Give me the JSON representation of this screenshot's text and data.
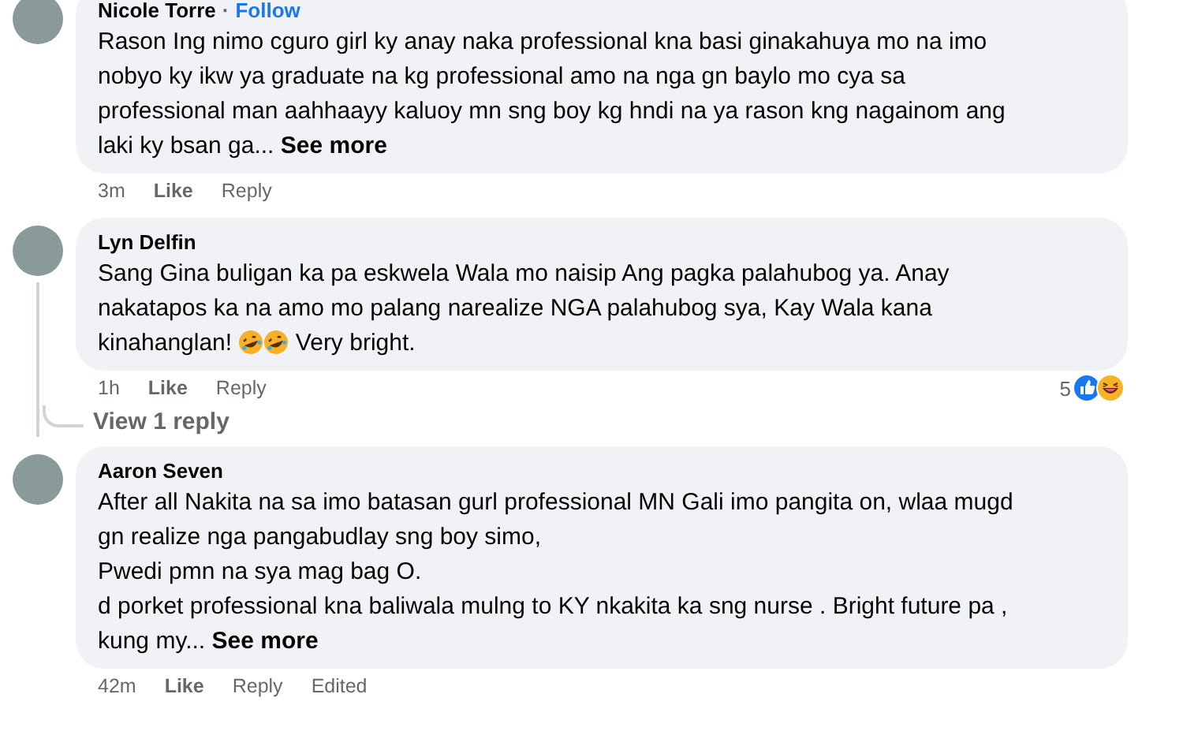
{
  "comments": [
    {
      "author": "Nicole Torre",
      "separator": "·",
      "follow": "Follow",
      "text_lines": [
        "Rason Ing nimo cguro girl ky anay naka professional kna basi ginakahuya mo na imo",
        "nobyo ky ikw ya graduate na kg professional amo na nga gn baylo mo cya sa",
        "professional man aahhaayy kaluoy mn sng boy kg hndi na ya rason kng nagainom ang",
        "laki ky bsan ga... **See more**"
      ],
      "time": "3m",
      "actions": [
        "Like",
        "Reply"
      ]
    },
    {
      "author": "Lyn Delfin",
      "text_lines": [
        "Sang Gina buligan ka pa eskwela Wala mo naisip Ang pagka palahubog ya. Anay",
        "nakatapos ka na amo mo palang narealize NGA palahubog sya, Kay Wala kana",
        "kinahanglan!"
      ],
      "inline_icons": [
        {
          "kind": "laughing"
        },
        {
          "kind": "laughing"
        }
      ],
      "after_icons": "Very bright.",
      "time": "1h",
      "actions": [
        "Like",
        "Reply"
      ],
      "reactions": {
        "count": "5",
        "icons": [
          {
            "kind": "like"
          },
          {
            "kind": "haha"
          }
        ]
      },
      "replies_link": "View 1 reply"
    },
    {
      "author": "Aaron Seven",
      "text_lines": [
        "After all Nakita na sa imo batasan gurl professional MN Gali imo pangita on, wlaa mugd",
        "gn realize nga pangabudlay sng boy simo,",
        "Pwedi pmn na sya mag bag O.",
        "d porket professional kna baliwala mulng to KY nkakita ka sng nurse . Bright future pa ,",
        "kung my... **See more**"
      ],
      "time": "42m",
      "actions": [
        "Like",
        "Reply"
      ],
      "edited": "Edited"
    }
  ]
}
